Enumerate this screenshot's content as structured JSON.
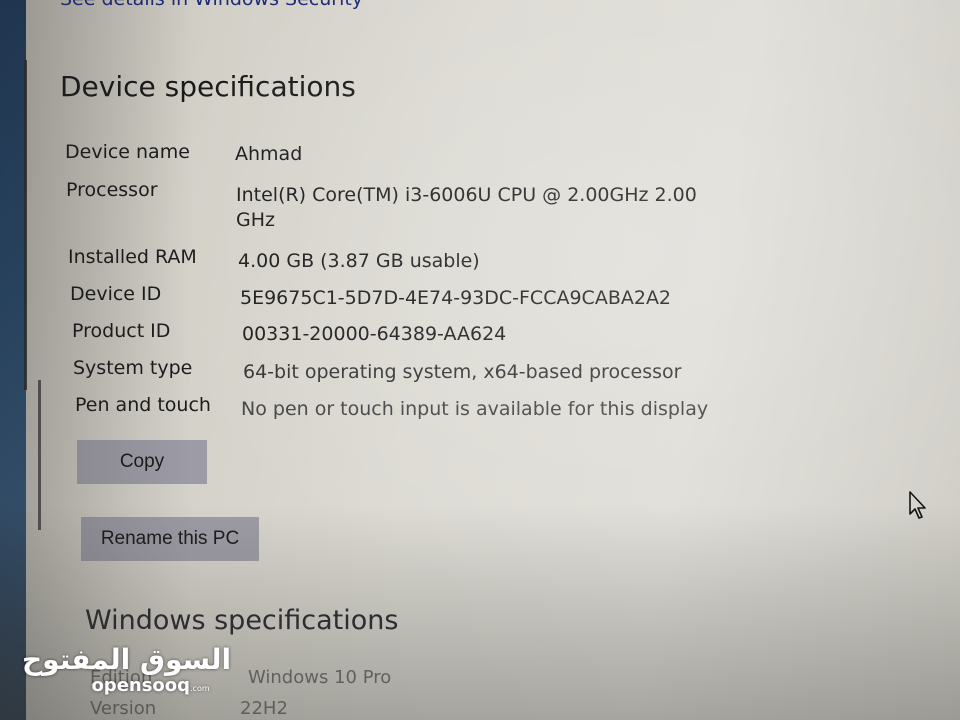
{
  "header": {
    "security_link": "See details in Windows Security"
  },
  "device_specifications": {
    "title": "Device specifications",
    "rows": [
      {
        "label": "Device name",
        "value": "Ahmad"
      },
      {
        "label": "Processor",
        "value": "Intel(R) Core(TM) i3-6006U CPU @ 2.00GHz   2.00",
        "value_line2": "GHz"
      },
      {
        "label": "Installed RAM",
        "value": "4.00 GB (3.87 GB usable)"
      },
      {
        "label": "Device ID",
        "value": "5E9675C1-5D7D-4E74-93DC-FCCA9CABA2A2"
      },
      {
        "label": "Product ID",
        "value": "00331-20000-64389-AA624"
      },
      {
        "label": "System type",
        "value": "64-bit operating system, x64-based processor"
      },
      {
        "label": "Pen and touch",
        "value": "No pen or touch input is available for this display"
      }
    ],
    "copy_button": "Copy",
    "rename_button": "Rename this PC"
  },
  "windows_specifications": {
    "title": "Windows specifications",
    "rows": [
      {
        "label": "Edition",
        "value": "Windows 10 Pro"
      },
      {
        "label": "Version",
        "value": "22H2"
      }
    ]
  },
  "watermark": {
    "arabic": "السوق المفتوح",
    "latin": "opensooq",
    "suffix": ".com"
  },
  "colors": {
    "link": "#1c2a7a",
    "button_bg": "#9d9ca6",
    "text": "#1b1b1b"
  }
}
